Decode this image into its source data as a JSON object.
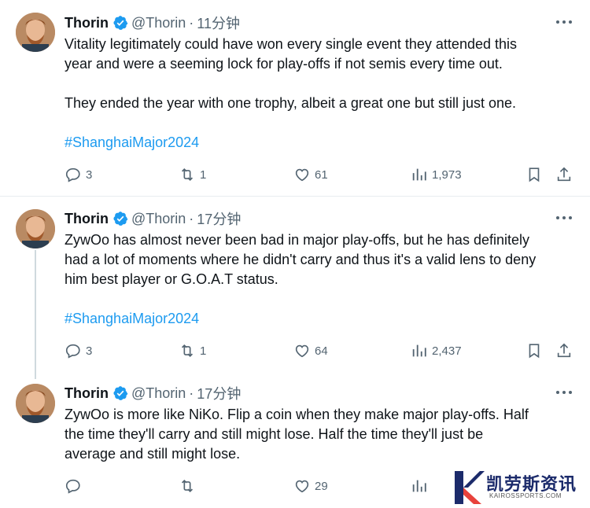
{
  "tweets": [
    {
      "name": "Thorin",
      "handle": "@Thorin",
      "dot": "·",
      "time": "11分钟",
      "text": "Vitality legitimately could have won every single event they attended this\nyear and were a seeming lock for play-offs if not semis every time out.\n\nThey ended the year with one trophy, albeit a great one but still just one.",
      "hashtag": "#ShanghaiMajor2024",
      "replies": "3",
      "retweets": "1",
      "likes": "61",
      "views": "1,973"
    },
    {
      "name": "Thorin",
      "handle": "@Thorin",
      "dot": "·",
      "time": "17分钟",
      "text": "ZywOo has almost never been bad in major play-offs, but he has definitely\nhad a lot of moments where he didn't carry and thus it's a valid lens to deny\nhim best player or G.O.A.T status.",
      "hashtag": "#ShanghaiMajor2024",
      "replies": "3",
      "retweets": "1",
      "likes": "64",
      "views": "2,437"
    },
    {
      "name": "Thorin",
      "handle": "@Thorin",
      "dot": "·",
      "time": "17分钟",
      "text": "ZywOo is more like NiKo.  Flip a coin when they make major play-offs.  Half\nthe time they'll carry and still might lose.  Half the time they'll just be\naverage and still might lose.",
      "hashtag": "",
      "replies": "",
      "retweets": "",
      "likes": "29",
      "views": ""
    }
  ],
  "watermark": {
    "title": "凯劳斯资讯",
    "subtitle": "KAIROSSPORTS.COM"
  },
  "colors": {
    "text": "#0f1419",
    "secondary": "#536471",
    "hashtag": "#1d9bf0",
    "verified": "#1d9bf0",
    "thread_line": "#cfd9de"
  }
}
